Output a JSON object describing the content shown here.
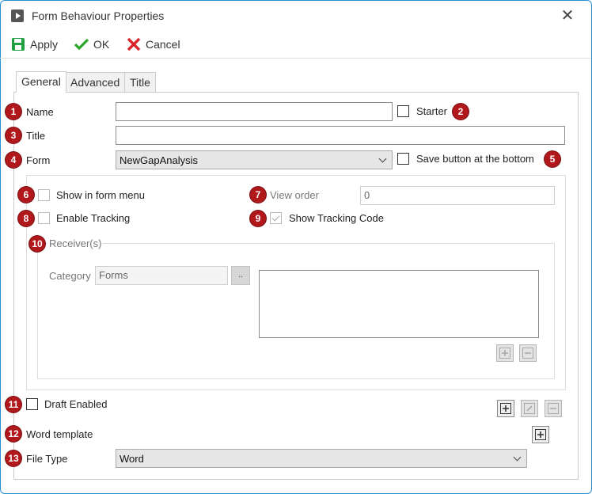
{
  "window": {
    "title": "Form Behaviour Properties"
  },
  "toolbar": {
    "apply_label": "Apply",
    "ok_label": "OK",
    "cancel_label": "Cancel"
  },
  "tabs": [
    {
      "label": "General",
      "active": true
    },
    {
      "label": "Advanced",
      "active": false
    },
    {
      "label": "Title",
      "active": false
    }
  ],
  "fields": {
    "name": {
      "label": "Name",
      "value": "",
      "badge": "1"
    },
    "starter": {
      "label": "Starter",
      "checked": false,
      "badge": "2"
    },
    "title": {
      "label": "Title",
      "value": "",
      "badge": "3"
    },
    "form": {
      "label": "Form",
      "value": "NewGapAnalysis",
      "badge": "4"
    },
    "save_bottom": {
      "label": "Save button at the bottom",
      "checked": false,
      "badge": "5"
    },
    "show_in_menu": {
      "label": "Show in form menu",
      "checked": false,
      "badge": "6"
    },
    "view_order": {
      "label": "View order",
      "value": "0",
      "badge": "7"
    },
    "enable_tracking": {
      "label": "Enable Tracking",
      "checked": false,
      "badge": "8"
    },
    "show_tracking_code": {
      "label": "Show Tracking Code",
      "checked": true,
      "badge": "9"
    },
    "receivers": {
      "label": "Receiver(s)",
      "badge": "10",
      "category_label": "Category",
      "category_value": "Forms",
      "ellipsis": ".."
    },
    "draft_enabled": {
      "label": "Draft Enabled",
      "checked": false,
      "badge": "11"
    },
    "word_template": {
      "label": "Word template",
      "badge": "12"
    },
    "file_type": {
      "label": "File Type",
      "value": "Word",
      "badge": "13"
    }
  },
  "icons": {
    "apply": "save-icon",
    "ok": "check-icon",
    "cancel": "cross-icon",
    "add": "plus-icon",
    "edit": "pencil-icon",
    "remove": "minus-icon"
  },
  "colors": {
    "badge": "#b0181c",
    "apply_icon": "#1e9e3e",
    "ok_icon": "#2aa52a",
    "cancel_icon": "#d9262a",
    "frame": "#2a8fd6"
  }
}
